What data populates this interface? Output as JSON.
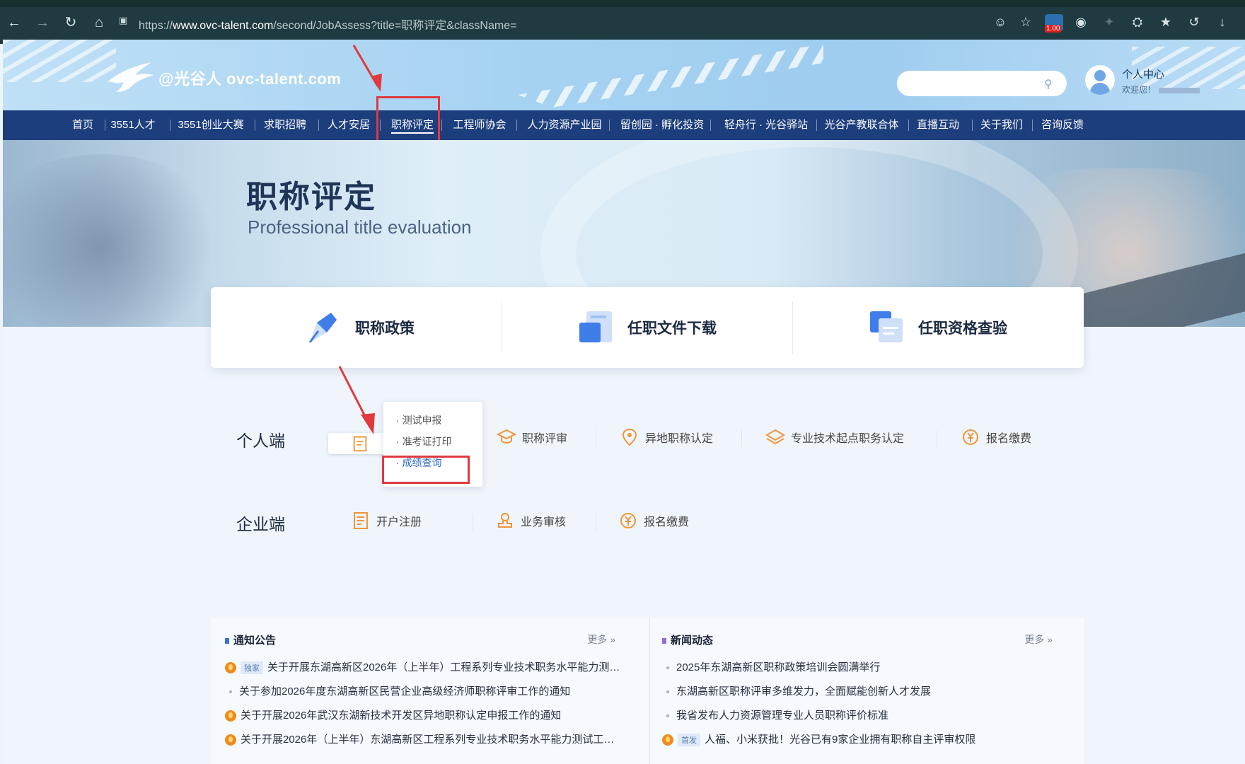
{
  "browser": {
    "url_prefix": "https://",
    "url_host": "www.ovc-talent.com",
    "url_path": "/second/JobAssess?title=职称评定&className=",
    "ext_badge": "1.00"
  },
  "header": {
    "logo_text": "@光谷人 ovc-talent.com",
    "search_placeholder": "",
    "user_center": "个人中心",
    "welcome": "欢迎您！"
  },
  "nav": {
    "items": [
      "首页",
      "3551人才",
      "3551创业大赛",
      "求职招聘",
      "人才安居",
      "职称评定",
      "工程师协会",
      "人力资源产业园",
      "留创园 · 孵化投资",
      "轻舟行 · 光谷驿站",
      "光谷产教联合体",
      "直播互动",
      "关于我们",
      "咨询反馈"
    ],
    "active_index": 5
  },
  "banner": {
    "title": "职称评定",
    "subtitle": "Professional title evaluation"
  },
  "cards": [
    "职称政策",
    "任职文件下载",
    "任职资格查验"
  ],
  "personal": {
    "label": "个人端",
    "services": [
      "职称评审",
      "异地职称认定",
      "专业技术起点职务认定",
      "报名缴费"
    ]
  },
  "popup": {
    "items": [
      "测试申报",
      "准考证打印",
      "成绩查询"
    ],
    "selected_index": 2
  },
  "enterprise": {
    "label": "企业端",
    "services": [
      "开户注册",
      "业务审核",
      "报名缴费"
    ]
  },
  "notices": {
    "title": "通知公告",
    "more": "更多",
    "rows": [
      {
        "hot": true,
        "tag": "独家",
        "text": "关于开展东湖高新区2026年（上半年）工程系列专业技术职务水平能力测…"
      },
      {
        "hot": false,
        "tag": "",
        "text": "关于参加2026年度东湖高新区民营企业高级经济师职称评审工作的通知"
      },
      {
        "hot": true,
        "tag": "",
        "text": "关于开展2026年武汉东湖新技术开发区异地职称认定申报工作的通知"
      },
      {
        "hot": true,
        "tag": "",
        "text": "关于开展2026年（上半年）东湖高新区工程系列专业技术职务水平能力测试工…"
      }
    ]
  },
  "news": {
    "title": "新闻动态",
    "more": "更多",
    "rows": [
      {
        "hot": false,
        "tag": "",
        "text": "2025年东湖高新区职称政策培训会圆满举行"
      },
      {
        "hot": false,
        "tag": "",
        "text": "东湖高新区职称评审多维发力，全面赋能创新人才发展"
      },
      {
        "hot": false,
        "tag": "",
        "text": "我省发布人力资源管理专业人员职称评价标准"
      },
      {
        "hot": true,
        "tag": "首发",
        "text": "人福、小米获批！光谷已有9家企业拥有职称自主评审权限"
      }
    ]
  }
}
